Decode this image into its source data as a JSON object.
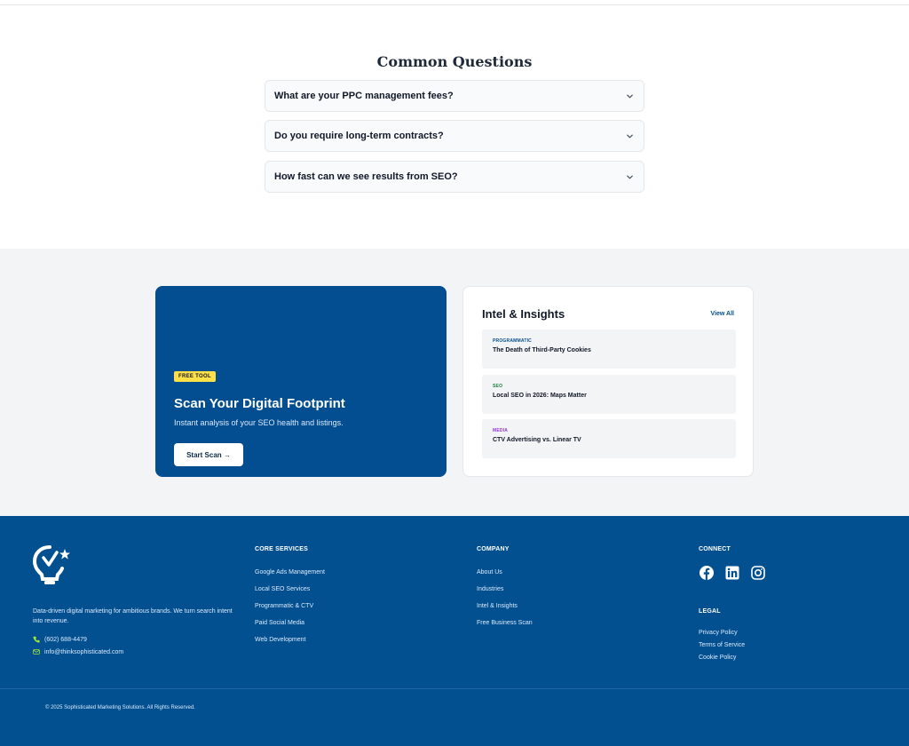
{
  "faq": {
    "title": "Common Questions",
    "items": [
      {
        "question": "What are your PPC management fees?"
      },
      {
        "question": "Do you require long-term contracts?"
      },
      {
        "question": "How fast can we see results from SEO?"
      }
    ]
  },
  "scan": {
    "badge": "FREE TOOL",
    "title": "Scan Your Digital Footprint",
    "subtitle": "Instant analysis of your SEO health and listings.",
    "button": "Start Scan →"
  },
  "intel": {
    "title": "Intel & Insights",
    "view_all": "View All",
    "posts": [
      {
        "category": "PROGRAMMATIC",
        "title": "The Death of Third-Party Cookies",
        "color": "#024e91"
      },
      {
        "category": "SEO",
        "title": "Local SEO in 2026: Maps Matter",
        "color": "#15803d"
      },
      {
        "category": "MEDIA",
        "title": "CTV Advertising vs. Linear TV",
        "color": "#9333ea"
      }
    ]
  },
  "footer": {
    "description": "Data-driven digital marketing for ambitious brands. We turn search intent into revenue.",
    "phone": "(602) 688-4479",
    "email": "info@thinksophisticated.com",
    "services": {
      "heading": "CORE SERVICES",
      "links": [
        "Google Ads Management",
        "Local SEO Services",
        "Programmatic & CTV",
        "Paid Social Media",
        "Web Development"
      ]
    },
    "company": {
      "heading": "COMPANY",
      "links": [
        "About Us",
        "Industries",
        "Intel & Insights",
        "Free Business Scan"
      ]
    },
    "connect": {
      "heading": "CONNECT",
      "icons": [
        "facebook-icon",
        "linkedin-icon",
        "instagram-icon"
      ]
    },
    "legal": {
      "heading": "LEGAL",
      "links": [
        "Privacy Policy",
        "Terms of Service",
        "Cookie Policy"
      ]
    },
    "copyright": "© 2025 Sophisticated Marketing Solutions. All Rights Reserved."
  },
  "colors": {
    "brand_blue": "#024e91",
    "footer_blue": "#02508f",
    "badge_yellow": "#fde047",
    "contact_icon_lime": "#a3e635"
  }
}
